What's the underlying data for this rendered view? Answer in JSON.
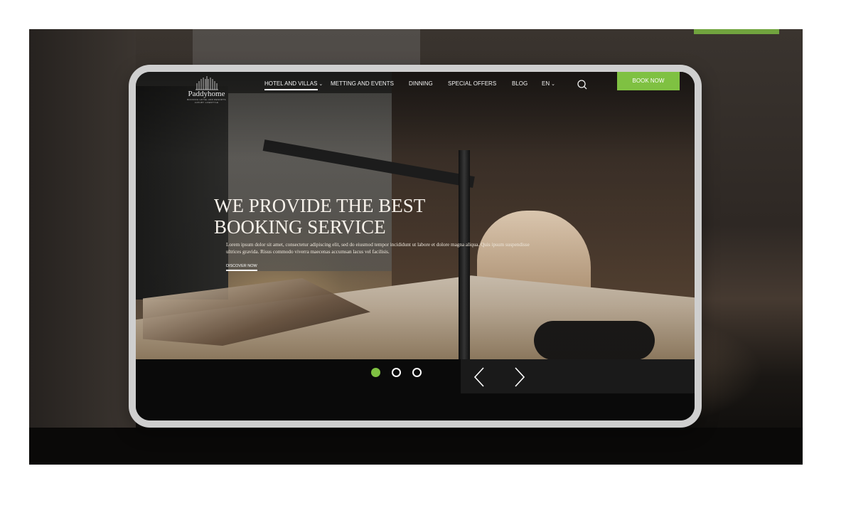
{
  "brand": {
    "name": "Paddyhome",
    "tagline_line1": "BOOKING HOTEL AND RESORTS",
    "tagline_line2": "LUXURY LIFESTYLE"
  },
  "nav": {
    "items": [
      {
        "label": "HOTEL AND VILLAS",
        "has_dropdown": true,
        "active": true
      },
      {
        "label": "METTING AND EVENTS",
        "has_dropdown": false
      },
      {
        "label": "DINNING",
        "has_dropdown": false
      },
      {
        "label": "SPECIAL OFFERS",
        "has_dropdown": false
      },
      {
        "label": "BLOG",
        "has_dropdown": false
      },
      {
        "label": "EN",
        "has_dropdown": true
      }
    ],
    "search_icon": "search-icon",
    "book_now_label": "BOOK NOW"
  },
  "hero": {
    "title_line1": "WE PROVIDE THE BEST",
    "title_line2": "BOOKING SERVICE",
    "description": "Lorem ipsum dolor sit amet, consectetur adipiscing elit, sed do eiusmod tempor incididunt ut labore et dolore magna aliqua. Quis ipsum suspendisse ultrices gravida. Risus commodo viverra maecenas accumsan lacus vel facilisis.",
    "cta_label": "DISCOVER NOW"
  },
  "slider": {
    "slide_count": 3,
    "active_index": 0,
    "prev_icon": "chevron-left-icon",
    "next_icon": "chevron-right-icon"
  },
  "colors": {
    "accent": "#7fc142",
    "frame": "#cfcfcf",
    "bar": "#0a0a0a",
    "text_light": "#ffffff"
  }
}
